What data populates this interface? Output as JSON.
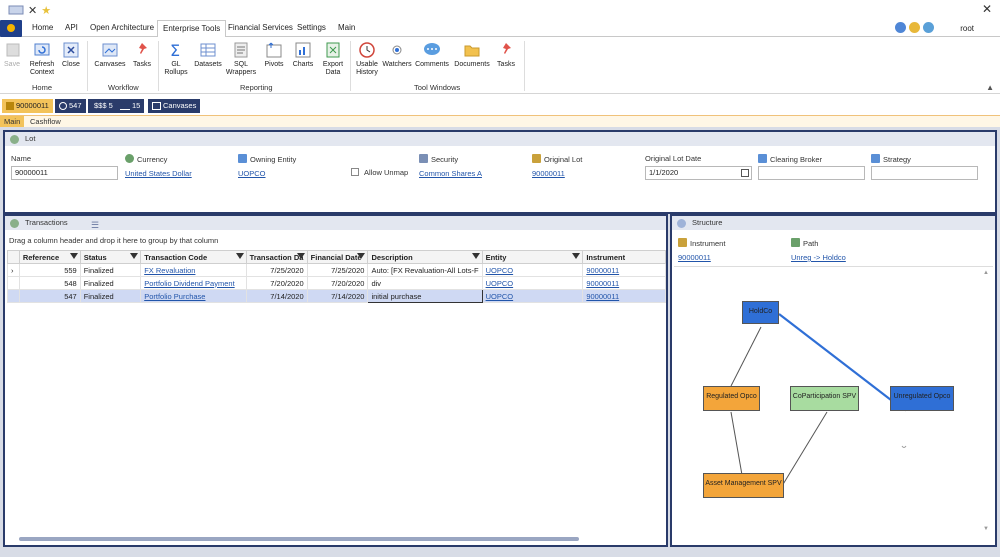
{
  "title_bar": {
    "icons": [
      "toolbar-icon",
      "close-icon",
      "star-icon"
    ]
  },
  "menu": {
    "tabs": [
      "Home",
      "API",
      "Open Architecture",
      "Enterprise Tools",
      "Financial Services",
      "Settings",
      "Main"
    ],
    "active": "Enterprise Tools",
    "user": "root"
  },
  "ribbon": {
    "buttons": [
      {
        "label": "Save",
        "icon": "save-icon"
      },
      {
        "label": "Refresh\nContext",
        "icon": "refresh-icon"
      },
      {
        "label": "Close",
        "icon": "close-icon"
      },
      {
        "label": "Canvases",
        "icon": "canvas-icon"
      },
      {
        "label": "Tasks",
        "icon": "pin-icon"
      },
      {
        "label": "GL\nRollups",
        "icon": "sigma-icon"
      },
      {
        "label": "Datasets",
        "icon": "dataset-icon"
      },
      {
        "label": "SQL\nWrappers",
        "icon": "sql-icon"
      },
      {
        "label": "Pivots",
        "icon": "pivot-icon"
      },
      {
        "label": "Charts",
        "icon": "chart-icon"
      },
      {
        "label": "Export\nData",
        "icon": "excel-icon"
      },
      {
        "label": "Usable\nHistory",
        "icon": "history-icon"
      },
      {
        "label": "Watchers",
        "icon": "eye-icon"
      },
      {
        "label": "Comments",
        "icon": "comment-icon"
      },
      {
        "label": "Documents",
        "icon": "folder-icon"
      },
      {
        "label": "Tasks",
        "icon": "pin-icon"
      }
    ],
    "groups": [
      "Home",
      "Workflow",
      "Reporting",
      "Tool Windows"
    ]
  },
  "toolstrip": {
    "chips": [
      {
        "label": "90000011",
        "icon": "lot-icon",
        "selected": true
      },
      {
        "label": "547",
        "icon": "clock-icon",
        "selected": false
      },
      {
        "label": "$$$ 5",
        "icon": "money-icon",
        "selected": false
      },
      {
        "label": "15",
        "icon": "scale-icon",
        "selected": false
      },
      {
        "label": "Canvases",
        "icon": "canvas-icon",
        "selected": false
      }
    ]
  },
  "subtabs": [
    "Main",
    "Cashflow"
  ],
  "lot": {
    "header": "Lot",
    "fields": {
      "name": {
        "label": "Name",
        "value": "90000011"
      },
      "currency": {
        "label": "Currency",
        "value": "United States Dollar"
      },
      "owning_entity": {
        "label": "Owning Entity",
        "value": "UOPCO"
      },
      "allow_unmap": {
        "label": "Allow Unmap"
      },
      "security": {
        "label": "Security",
        "value": "Common Shares A"
      },
      "original_lot": {
        "label": "Original Lot",
        "value": "90000011"
      },
      "original_lot_date": {
        "label": "Original Lot Date",
        "value": "1/1/2020"
      },
      "clearing_broker": {
        "label": "Clearing Broker",
        "value": ""
      },
      "strategy": {
        "label": "Strategy",
        "value": ""
      }
    }
  },
  "transactions": {
    "header": "Transactions",
    "group_hint": "Drag a column header and drop it here to group by that column",
    "columns": [
      "Reference",
      "Status",
      "Transaction Code",
      "Transaction Da",
      "Financial Date",
      "Description",
      "Entity",
      "Instrument"
    ],
    "rows": [
      [
        "559",
        "Finalized",
        "FX Revaluation",
        "7/25/2020",
        "7/25/2020",
        "Auto: [FX Revaluation-All Lots-F",
        "UOPCO",
        "90000011"
      ],
      [
        "548",
        "Finalized",
        "Portfolio Dividend Payment",
        "7/20/2020",
        "7/20/2020",
        "div",
        "UOPCO",
        "90000011"
      ],
      [
        "547",
        "Finalized",
        "Portfolio Purchase",
        "7/14/2020",
        "7/14/2020",
        "initial purchase",
        "UOPCO",
        "90000011"
      ]
    ]
  },
  "structure": {
    "header": "Structure",
    "instrument_label": "Instrument",
    "instrument_value": "90000011",
    "path_label": "Path",
    "path_value": "Unreg -> Holdco",
    "nodes": [
      "HoldCo",
      "Regulated Opco",
      "CoParticipation SPV",
      "Unregulated Opco",
      "Asset Management SPV"
    ],
    "colors": {
      "holdco": "#2f6fd6",
      "regulated": "#f3a53a",
      "copart": "#a8dca0",
      "unregulated": "#2f6fd6",
      "asset": "#f3a53a"
    }
  }
}
